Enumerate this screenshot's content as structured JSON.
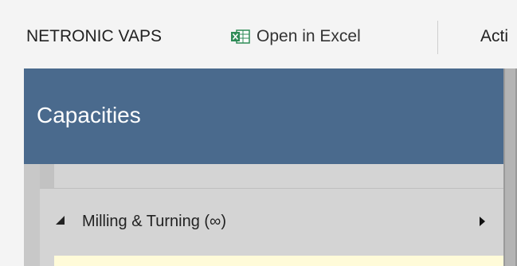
{
  "toolbar": {
    "vaps_label": "NETRONIC VAPS",
    "excel_label": "Open in Excel",
    "excel_icon": "excel-icon",
    "actions_label": "Acti"
  },
  "panel": {
    "title": "Capacities",
    "header_color": "#4a6a8d",
    "group": {
      "label": "Milling & Turning (∞)",
      "state": "expanded"
    }
  }
}
